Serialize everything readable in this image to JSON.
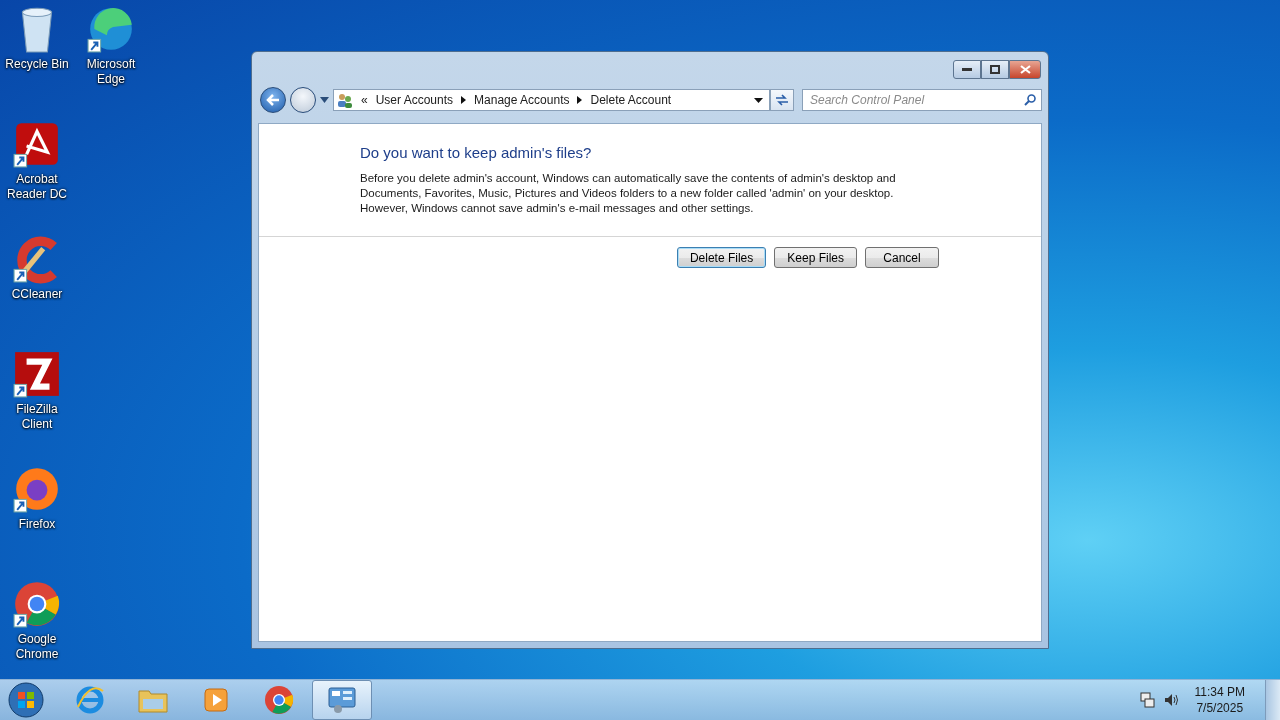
{
  "desktop_icons": [
    {
      "label": "Recycle Bin",
      "kind": "recycle",
      "shortcut": false
    },
    {
      "label": "Microsoft Edge",
      "kind": "edge",
      "shortcut": true
    },
    {
      "label": "Acrobat Reader DC",
      "kind": "acrobat",
      "shortcut": true
    },
    {
      "label": "CCleaner",
      "kind": "ccleaner",
      "shortcut": true
    },
    {
      "label": "FileZilla Client",
      "kind": "filezilla",
      "shortcut": true
    },
    {
      "label": "Firefox",
      "kind": "firefox",
      "shortcut": true
    },
    {
      "label": "Google Chrome",
      "kind": "chrome",
      "shortcut": true
    }
  ],
  "window": {
    "breadcrumb": [
      "«",
      "User Accounts",
      "Manage Accounts",
      "Delete Account"
    ],
    "search": {
      "placeholder": "Search Control Panel"
    },
    "heading": "Do you want to keep admin's files?",
    "body": "Before you delete admin's account, Windows can automatically save the contents of admin's desktop and Documents, Favorites, Music, Pictures and Videos folders to a new folder called 'admin' on your desktop. However, Windows cannot save admin's e-mail messages and other settings.",
    "buttons": [
      {
        "label": "Delete Files",
        "default": true
      },
      {
        "label": "Keep Files",
        "default": false
      },
      {
        "label": "Cancel",
        "default": false
      }
    ]
  },
  "taskbar": {
    "apps": [
      {
        "kind": "ie",
        "active": false
      },
      {
        "kind": "explorer",
        "active": false
      },
      {
        "kind": "media",
        "active": false
      },
      {
        "kind": "chrome",
        "active": false
      },
      {
        "kind": "controlpanel",
        "active": true
      }
    ],
    "clock": {
      "time": "11:34 PM",
      "date": "7/5/2025"
    }
  }
}
